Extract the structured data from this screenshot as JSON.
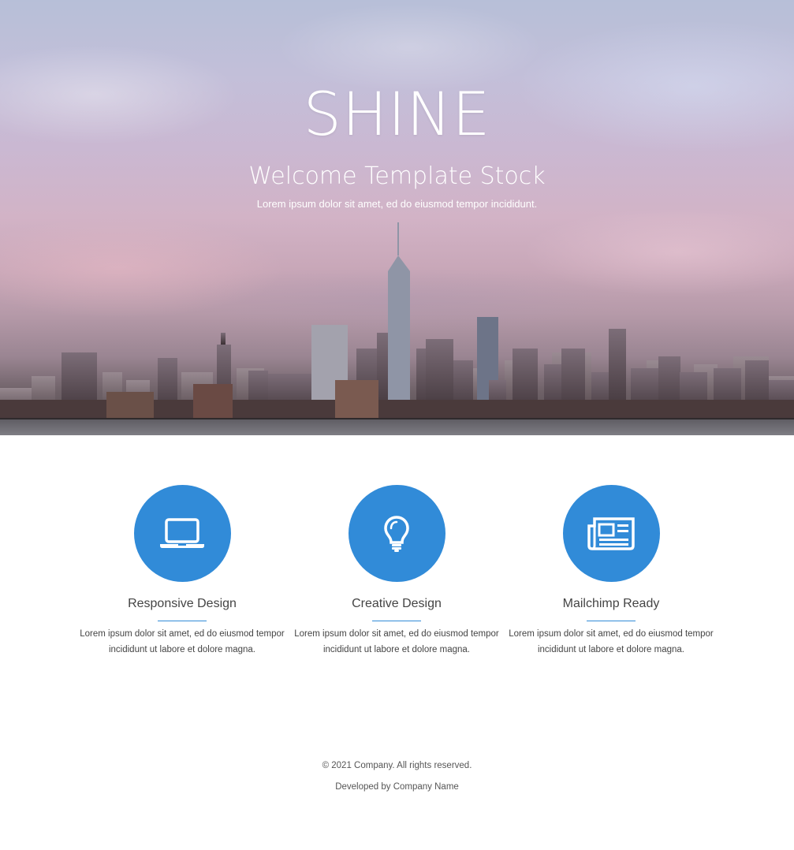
{
  "hero": {
    "title": "SHINE",
    "subtitle": "Welcome Template Stock",
    "lead": "Lorem ipsum dolor sit amet, ed do eiusmod tempor incididunt."
  },
  "features": [
    {
      "icon": "laptop-icon",
      "title": "Responsive Design",
      "text": "Lorem ipsum dolor sit amet, ed do eiusmod tempor incididunt ut labore et dolore magna."
    },
    {
      "icon": "lightbulb-icon",
      "title": "Creative Design",
      "text": "Lorem ipsum dolor sit amet, ed do eiusmod tempor incididunt ut labore et dolore magna."
    },
    {
      "icon": "newspaper-icon",
      "title": "Mailchimp Ready",
      "text": "Lorem ipsum dolor sit amet, ed do eiusmod tempor incididunt ut labore et dolore magna."
    }
  ],
  "footer": {
    "copyright": "© 2021 Company. All rights reserved.",
    "developed_by": "Developed by Company Name"
  },
  "colors": {
    "accent": "#318bd8",
    "text": "#444444",
    "hero_text": "#ffffff"
  }
}
